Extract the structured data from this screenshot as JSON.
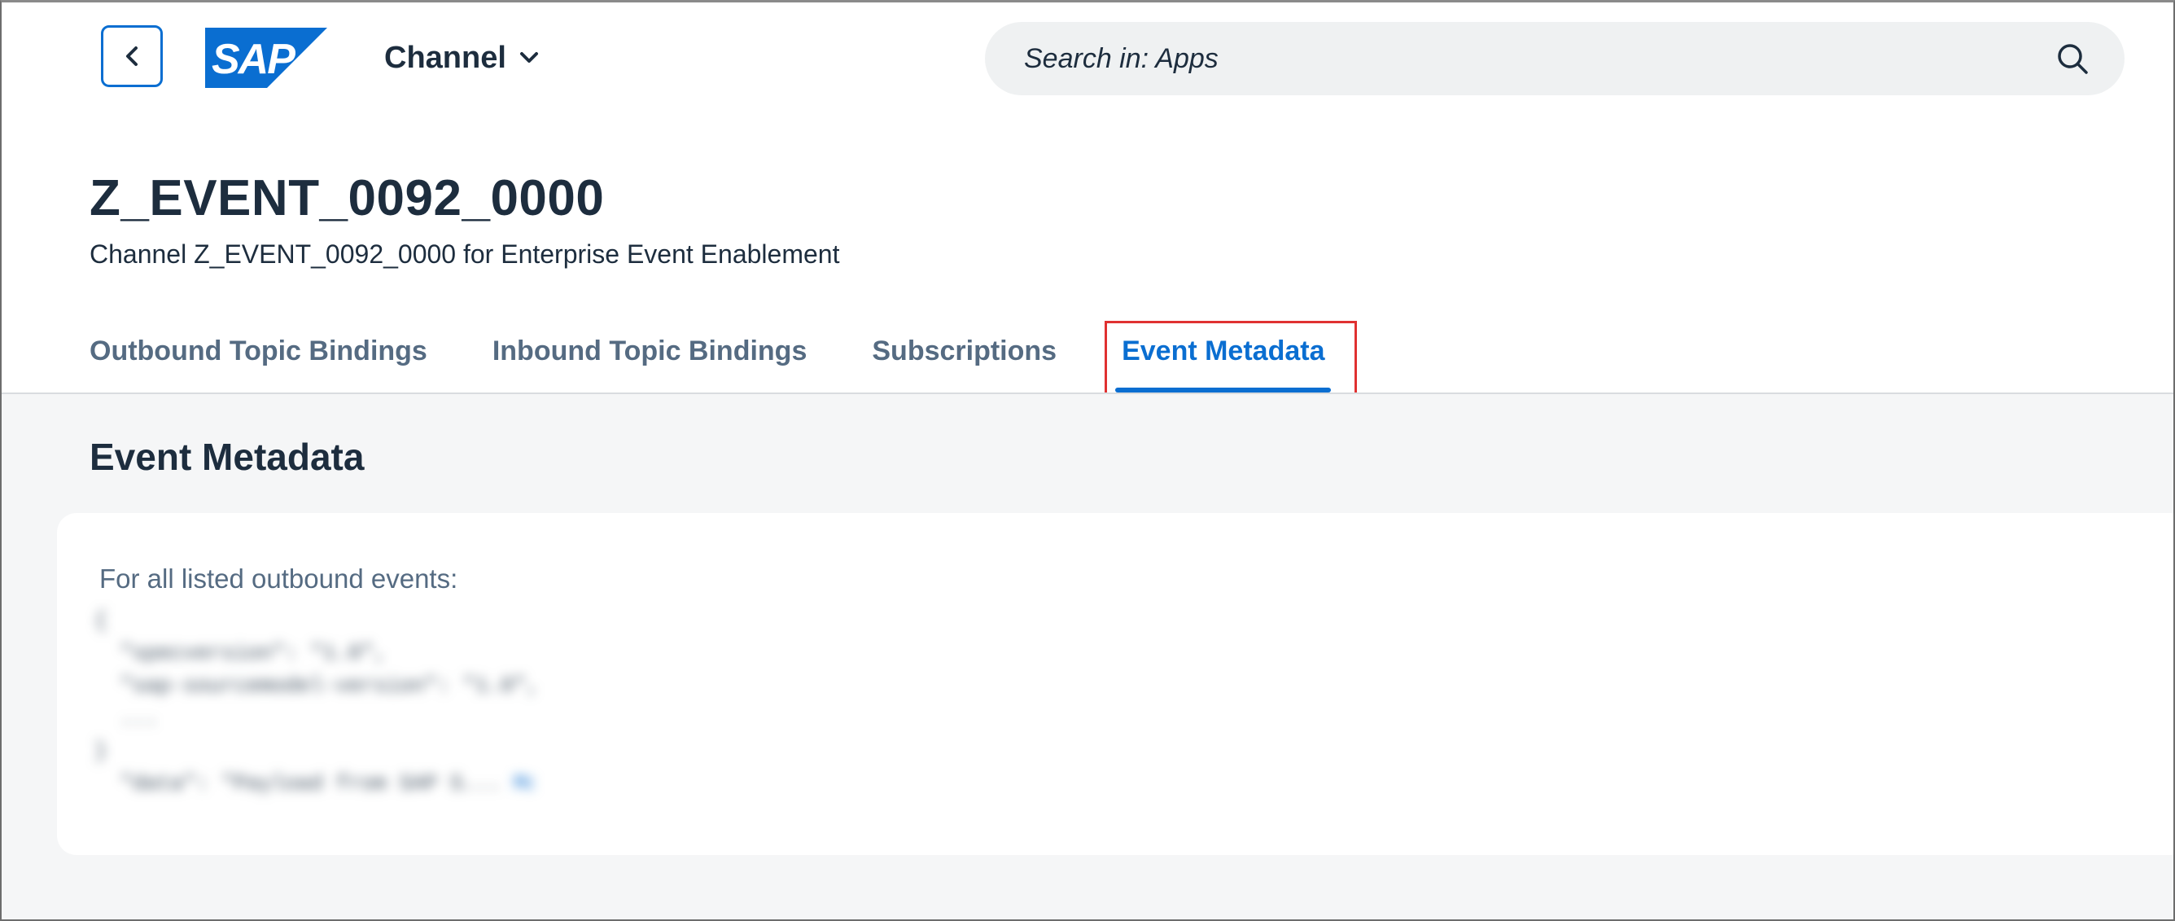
{
  "shell": {
    "app_title": "Channel",
    "search_placeholder": "Search in: Apps",
    "brand_text": "SAP"
  },
  "header": {
    "title": "Z_EVENT_0092_0000",
    "subtitle": "Channel Z_EVENT_0092_0000 for Enterprise Event Enablement"
  },
  "tabs": [
    {
      "label": "Outbound Topic Bindings",
      "active": false
    },
    {
      "label": "Inbound Topic Bindings",
      "active": false
    },
    {
      "label": "Subscriptions",
      "active": false
    },
    {
      "label": "Event Metadata",
      "active": true
    }
  ],
  "section": {
    "title": "Event Metadata",
    "card_label": "For all listed outbound events:"
  },
  "colors": {
    "accent": "#0a6ed1",
    "text": "#1d2d3e",
    "muted": "#556b82",
    "highlight": "#e03131",
    "content_bg": "#f5f6f7"
  },
  "icons": {
    "back": "chevron-left-icon",
    "dropdown": "chevron-down-icon",
    "search": "search-icon"
  }
}
